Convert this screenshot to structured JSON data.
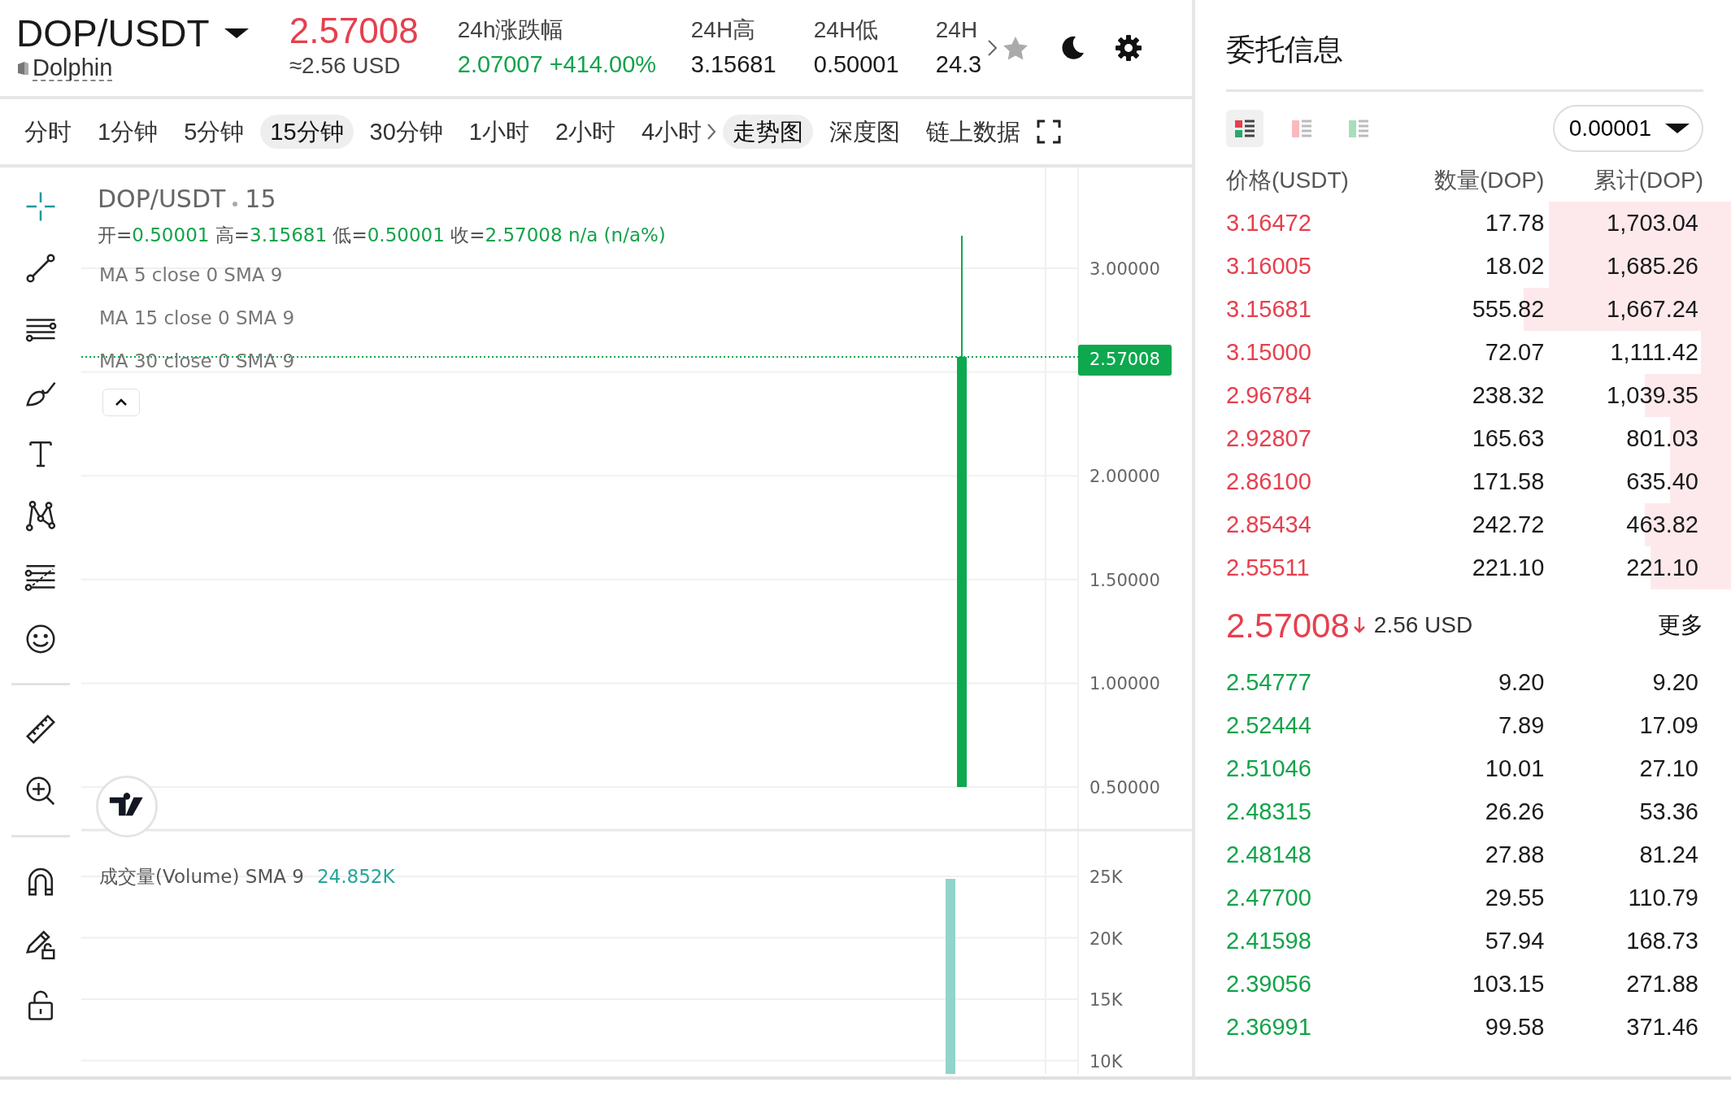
{
  "header": {
    "pair": "DOP/USDT",
    "token_name": "Dolphin",
    "price": "2.57008",
    "price_usd": "≈2.56 USD",
    "stats": [
      {
        "label": "24h涨跌幅",
        "value": "2.07007 +414.00%",
        "color": "#13a34a"
      },
      {
        "label": "24H高",
        "value": "3.15681",
        "color": "#1a1a1a"
      },
      {
        "label": "24H低",
        "value": "0.50001",
        "color": "#1a1a1a"
      },
      {
        "label": "24H",
        "value": "24.3",
        "color": "#1a1a1a"
      }
    ]
  },
  "interval_tabs": [
    {
      "label": "分时",
      "selected": false
    },
    {
      "label": "1分钟",
      "selected": false
    },
    {
      "label": "5分钟",
      "selected": false
    },
    {
      "label": "15分钟",
      "selected": true
    },
    {
      "label": "30分钟",
      "selected": false
    },
    {
      "label": "1小时",
      "selected": false
    },
    {
      "label": "2小时",
      "selected": false
    },
    {
      "label": "4小时",
      "selected": false
    }
  ],
  "view_tabs": [
    {
      "label": "走势图",
      "selected": true
    },
    {
      "label": "深度图",
      "selected": false
    },
    {
      "label": "链上数据",
      "selected": false
    }
  ],
  "drawing_tools": [
    {
      "selected": true
    },
    {
      "selected": false
    },
    {
      "selected": false
    },
    {
      "selected": false
    },
    {
      "selected": false
    },
    {
      "selected": false
    },
    {
      "selected": false
    },
    {
      "selected": false
    },
    {
      "selected": false
    },
    {
      "selected": false
    },
    {
      "selected": false
    },
    {
      "selected": false
    },
    {
      "selected": false
    }
  ],
  "chart": {
    "symbol": "DOP/USDT",
    "interval": "15",
    "ohlc": [
      {
        "label": "开=",
        "value": "0.50001"
      },
      {
        "label": "高=",
        "value": "3.15681"
      },
      {
        "label": "低=",
        "value": "0.50001"
      },
      {
        "label": "收=",
        "value": "2.57008"
      }
    ],
    "change": "n/a (n/a%)",
    "indicators": [
      "MA 5 close 0 SMA 9",
      "MA 15 close 0 SMA 9",
      "MA 30 close 0 SMA 9"
    ],
    "price_ticks": [
      "3.00000",
      "2.00000",
      "1.50000",
      "1.00000",
      "0.50000"
    ],
    "last_price": "2.57008",
    "volume_legend": "成交量(Volume) SMA 9",
    "volume_value": "24.852K",
    "volume_ticks": [
      "25K",
      "20K",
      "15K",
      "10K"
    ]
  },
  "order_book": {
    "title": "委托信息",
    "views": [
      {
        "selected": true
      },
      {
        "selected": false
      },
      {
        "selected": false
      }
    ],
    "precision": "0.00001",
    "columns": [
      "价格(USDT)",
      "数量(DOP)",
      "累计(DOP)"
    ],
    "asks": [
      {
        "price": "3.16472",
        "amount": "17.78",
        "total": "1,703.04",
        "level": 0.36
      },
      {
        "price": "3.16005",
        "amount": "18.02",
        "total": "1,685.26",
        "level": 0.36
      },
      {
        "price": "3.15681",
        "amount": "555.82",
        "total": "1,667.24",
        "level": 0.41
      },
      {
        "price": "3.15000",
        "amount": "72.07",
        "total": "1,111.42",
        "level": 0.06
      },
      {
        "price": "2.96784",
        "amount": "238.32",
        "total": "1,039.35",
        "level": 0.17
      },
      {
        "price": "2.92807",
        "amount": "165.63",
        "total": "801.03",
        "level": 0.12
      },
      {
        "price": "2.86100",
        "amount": "171.58",
        "total": "635.40",
        "level": 0.12
      },
      {
        "price": "2.85434",
        "amount": "242.72",
        "total": "463.82",
        "level": 0.17
      },
      {
        "price": "2.55511",
        "amount": "221.10",
        "total": "221.10",
        "level": 0.16
      }
    ],
    "last_price": "2.57008",
    "last_price_usd": "2.56 USD",
    "more": "更多",
    "bids": [
      {
        "price": "2.54777",
        "amount": "9.20",
        "total": "9.20"
      },
      {
        "price": "2.52444",
        "amount": "7.89",
        "total": "17.09"
      },
      {
        "price": "2.51046",
        "amount": "10.01",
        "total": "27.10"
      },
      {
        "price": "2.48315",
        "amount": "26.26",
        "total": "53.36"
      },
      {
        "price": "2.48148",
        "amount": "27.88",
        "total": "81.24"
      },
      {
        "price": "2.47700",
        "amount": "29.55",
        "total": "110.79"
      },
      {
        "price": "2.41598",
        "amount": "57.94",
        "total": "168.73"
      },
      {
        "price": "2.39056",
        "amount": "103.15",
        "total": "271.88"
      },
      {
        "price": "2.36991",
        "amount": "99.58",
        "total": "371.46"
      }
    ]
  }
}
